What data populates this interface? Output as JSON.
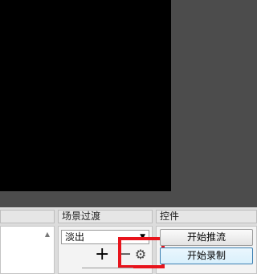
{
  "docks": {
    "scene_transitions": {
      "title": "场景过渡",
      "selected": "淡出"
    },
    "controls": {
      "title": "控件",
      "start_streaming": "开始推流",
      "start_recording": "开始录制"
    }
  },
  "icons": {
    "add": "+",
    "remove": "−",
    "settings": "⚙",
    "dropdown": "▼",
    "scroll_up": "▲"
  },
  "highlight": {
    "color": "#e8141c"
  }
}
